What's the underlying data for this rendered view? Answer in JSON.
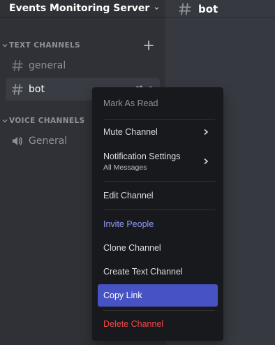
{
  "server": {
    "name": "Events Monitoring Server"
  },
  "topbar": {
    "channel_name": "bot"
  },
  "sidebar": {
    "text_category": "TEXT CHANNELS",
    "voice_category": "VOICE CHANNELS",
    "text_channels": [
      {
        "label": "general"
      },
      {
        "label": "bot",
        "selected": true
      }
    ],
    "voice_channels": [
      {
        "label": "General"
      }
    ]
  },
  "context_menu": {
    "mark_as_read": "Mark As Read",
    "mute_channel": "Mute Channel",
    "notification_settings": "Notification Settings",
    "notification_value": "All Messages",
    "edit_channel": "Edit Channel",
    "invite_people": "Invite People",
    "clone_channel": "Clone Channel",
    "create_text_channel": "Create Text Channel",
    "copy_link": "Copy Link",
    "delete_channel": "Delete Channel"
  },
  "colors": {
    "brand": "#8e9cf6",
    "highlight": "#4752c4",
    "danger": "#f04747"
  }
}
